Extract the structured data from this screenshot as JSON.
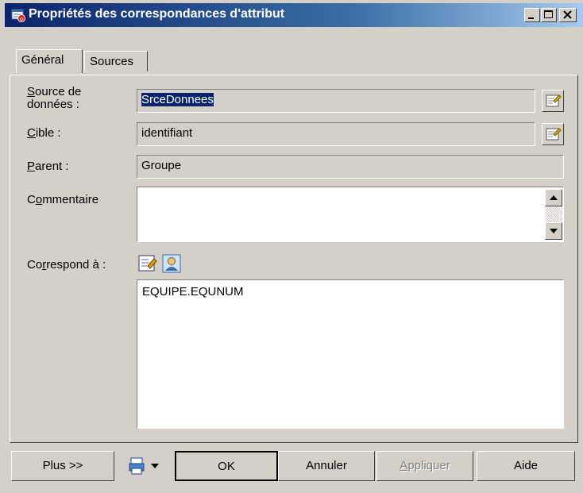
{
  "window": {
    "title": "Propriétés des correspondances d'attribut"
  },
  "tabs": [
    {
      "label": "Général",
      "active": true
    },
    {
      "label": "Sources",
      "active": false
    }
  ],
  "fields": {
    "source": {
      "label_line1": "ource de",
      "label_line1_accel": "S",
      "label_line2": "données :",
      "value": "SrceDonnees"
    },
    "cible": {
      "label_accel": "C",
      "label_rest": "ible :",
      "value": "identifiant"
    },
    "parent": {
      "label_accel": "P",
      "label_rest": "arent :",
      "value": "Groupe"
    },
    "commentaire": {
      "label_pre": "C",
      "label_accel": "o",
      "label_rest": "mmentaire",
      "value": ""
    },
    "correspond": {
      "label_pre": "Co",
      "label_accel": "r",
      "label_rest": "respond à :",
      "value": "EQUIPE.EQUNUM"
    }
  },
  "buttons": {
    "plus": "Plus >>",
    "ok": "OK",
    "annuler": "Annuler",
    "appliquer_accel": "A",
    "appliquer_rest": "ppliquer",
    "aide": "Aide"
  },
  "colors": {
    "title_start": "#0a246a",
    "title_end": "#a6caf0",
    "face": "#d4d0c8",
    "selection": "#0a246a"
  }
}
